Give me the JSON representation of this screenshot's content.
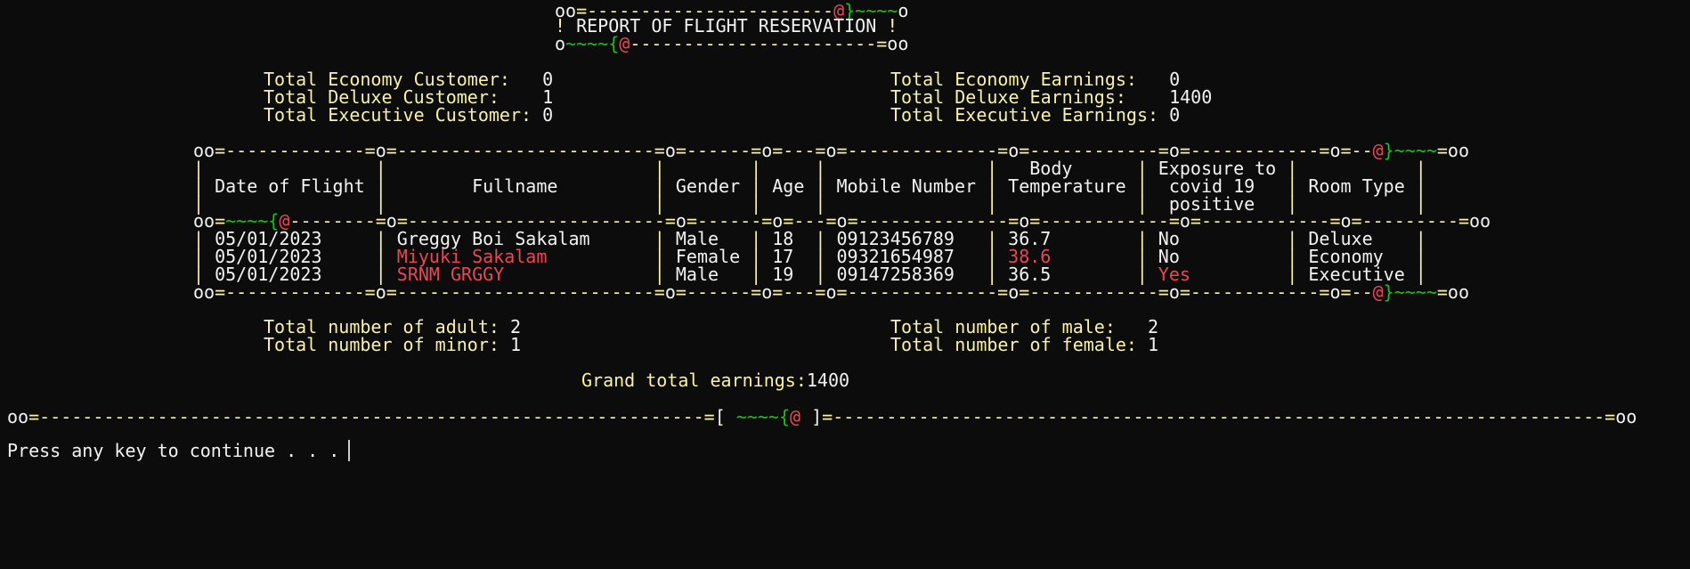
{
  "header": {
    "top_border": [
      {
        "t": "oo",
        "c": "w"
      },
      {
        "t": "=-----------------------",
        "c": "y"
      },
      {
        "t": "@",
        "c": "r"
      },
      {
        "t": "}~~~~",
        "c": "g"
      },
      {
        "t": "o",
        "c": "w"
      }
    ],
    "title_line": [
      {
        "t": "! ",
        "c": "y"
      },
      {
        "t": "REPORT OF FLIGHT RESERVATION",
        "c": "w"
      },
      {
        "t": " !",
        "c": "y"
      }
    ],
    "bottom_border": [
      {
        "t": "o",
        "c": "w"
      },
      {
        "t": "~~~~{",
        "c": "g"
      },
      {
        "t": "@",
        "c": "r"
      },
      {
        "t": "-----------------------=",
        "c": "y"
      },
      {
        "t": "oo",
        "c": "w"
      }
    ]
  },
  "summary": {
    "customers": [
      {
        "label": "Total Economy Customer:   ",
        "value": "0"
      },
      {
        "label": "Total Deluxe Customer:    ",
        "value": "1"
      },
      {
        "label": "Total Executive Customer: ",
        "value": "0"
      }
    ],
    "earnings": [
      {
        "label": "Total Economy Earnings:   ",
        "value": "0"
      },
      {
        "label": "Total Deluxe Earnings:    ",
        "value": "1400"
      },
      {
        "label": "Total Executive Earnings: ",
        "value": "0"
      }
    ]
  },
  "table": {
    "top_border": [
      {
        "t": "oo",
        "c": "w"
      },
      {
        "t": "=-------------=",
        "c": "y"
      },
      {
        "t": "o",
        "c": "w"
      },
      {
        "t": "=------------------------=",
        "c": "y"
      },
      {
        "t": "o",
        "c": "w"
      },
      {
        "t": "=------=",
        "c": "y"
      },
      {
        "t": "o",
        "c": "w"
      },
      {
        "t": "=---=",
        "c": "y"
      },
      {
        "t": "o",
        "c": "w"
      },
      {
        "t": "=--------------=",
        "c": "y"
      },
      {
        "t": "o",
        "c": "w"
      },
      {
        "t": "=------------=",
        "c": "y"
      },
      {
        "t": "o",
        "c": "w"
      },
      {
        "t": "=------------=",
        "c": "y"
      },
      {
        "t": "o",
        "c": "w"
      },
      {
        "t": "=--",
        "c": "y"
      },
      {
        "t": "@",
        "c": "r"
      },
      {
        "t": "}~~~~",
        "c": "g"
      },
      {
        "t": "=",
        "c": "y"
      },
      {
        "t": "oo",
        "c": "w"
      }
    ],
    "header_rows": [
      {
        "cells": [
          "",
          "",
          "",
          "",
          "",
          "   Body     ",
          " Exposure to ",
          ""
        ]
      },
      {
        "cells": [
          " Date of Flight ",
          "        Fullname         ",
          " Gender ",
          " Age ",
          " Mobile Number ",
          " Temperature ",
          "  covid 19   ",
          " Room Type "
        ]
      },
      {
        "cells": [
          "",
          "",
          "",
          "",
          "",
          "",
          "  positive   ",
          ""
        ]
      }
    ],
    "header_divider": [
      {
        "t": "oo",
        "c": "w"
      },
      {
        "t": "=",
        "c": "y"
      },
      {
        "t": "~~~~{",
        "c": "g"
      },
      {
        "t": "@",
        "c": "r"
      },
      {
        "t": "--------=",
        "c": "y"
      },
      {
        "t": "o",
        "c": "w"
      },
      {
        "t": "=------------------------=",
        "c": "y"
      },
      {
        "t": "o",
        "c": "w"
      },
      {
        "t": "=------=",
        "c": "y"
      },
      {
        "t": "o",
        "c": "w"
      },
      {
        "t": "=---=",
        "c": "y"
      },
      {
        "t": "o",
        "c": "w"
      },
      {
        "t": "=--------------=",
        "c": "y"
      },
      {
        "t": "o",
        "c": "w"
      },
      {
        "t": "=------------=",
        "c": "y"
      },
      {
        "t": "o",
        "c": "w"
      },
      {
        "t": "=------------=",
        "c": "y"
      },
      {
        "t": "o",
        "c": "w"
      },
      {
        "t": "=---------=",
        "c": "y"
      },
      {
        "t": "oo",
        "c": "w"
      }
    ],
    "rows": [
      {
        "cells": [
          {
            "t": " 05/01/2023",
            "c": "w"
          },
          {
            "t": " Greggy Boi Sakalam",
            "c": "w"
          },
          {
            "t": " Male",
            "c": "w"
          },
          {
            "t": " 18",
            "c": "w"
          },
          {
            "t": " 09123456789",
            "c": "w"
          },
          {
            "t": " 36.7",
            "c": "w"
          },
          {
            "t": " No",
            "c": "w"
          },
          {
            "t": " Deluxe",
            "c": "w"
          }
        ]
      },
      {
        "cells": [
          {
            "t": " 05/01/2023",
            "c": "w"
          },
          {
            "t": " Miyuki Sakalam",
            "c": "r"
          },
          {
            "t": " Female",
            "c": "w"
          },
          {
            "t": " 17",
            "c": "w"
          },
          {
            "t": " 09321654987",
            "c": "w"
          },
          {
            "t": " 38.6",
            "c": "r"
          },
          {
            "t": " No",
            "c": "w"
          },
          {
            "t": " Economy",
            "c": "w"
          }
        ]
      },
      {
        "cells": [
          {
            "t": " 05/01/2023",
            "c": "w"
          },
          {
            "t": " SRNM GRGGY",
            "c": "r"
          },
          {
            "t": " Male",
            "c": "w"
          },
          {
            "t": " 19",
            "c": "w"
          },
          {
            "t": " 09147258369",
            "c": "w"
          },
          {
            "t": " 36.5",
            "c": "w"
          },
          {
            "t": " Yes",
            "c": "r"
          },
          {
            "t": " Executive",
            "c": "w"
          }
        ]
      }
    ],
    "bottom_border": [
      {
        "t": "oo",
        "c": "w"
      },
      {
        "t": "=-------------=",
        "c": "y"
      },
      {
        "t": "o",
        "c": "w"
      },
      {
        "t": "=------------------------=",
        "c": "y"
      },
      {
        "t": "o",
        "c": "w"
      },
      {
        "t": "=------=",
        "c": "y"
      },
      {
        "t": "o",
        "c": "w"
      },
      {
        "t": "=---=",
        "c": "y"
      },
      {
        "t": "o",
        "c": "w"
      },
      {
        "t": "=--------------=",
        "c": "y"
      },
      {
        "t": "o",
        "c": "w"
      },
      {
        "t": "=------------=",
        "c": "y"
      },
      {
        "t": "o",
        "c": "w"
      },
      {
        "t": "=------------=",
        "c": "y"
      },
      {
        "t": "o",
        "c": "w"
      },
      {
        "t": "=--",
        "c": "y"
      },
      {
        "t": "@",
        "c": "r"
      },
      {
        "t": "}~~~~",
        "c": "g"
      },
      {
        "t": "=",
        "c": "y"
      },
      {
        "t": "oo",
        "c": "w"
      }
    ]
  },
  "totals": {
    "age": [
      {
        "label": "Total number of adult: ",
        "value": "2"
      },
      {
        "label": "Total number of minor: ",
        "value": "1"
      }
    ],
    "gender": [
      {
        "label": "Total number of male:   ",
        "value": "2"
      },
      {
        "label": "Total number of female: ",
        "value": "1"
      }
    ],
    "grand_total": {
      "label": "Grand total earnings:",
      "value": "1400"
    }
  },
  "footer": {
    "divider": [
      {
        "t": "oo",
        "c": "w"
      },
      {
        "t": "=--------------------------------------------------------------=",
        "c": "y"
      },
      {
        "t": "[ ",
        "c": "w"
      },
      {
        "t": "~~~~{",
        "c": "g"
      },
      {
        "t": "@",
        "c": "r"
      },
      {
        "t": " ]",
        "c": "w"
      },
      {
        "t": "=------------------------------------------------------------------------=",
        "c": "y"
      },
      {
        "t": "oo",
        "c": "w"
      }
    ],
    "prompt": "Press any key to continue . . ."
  }
}
